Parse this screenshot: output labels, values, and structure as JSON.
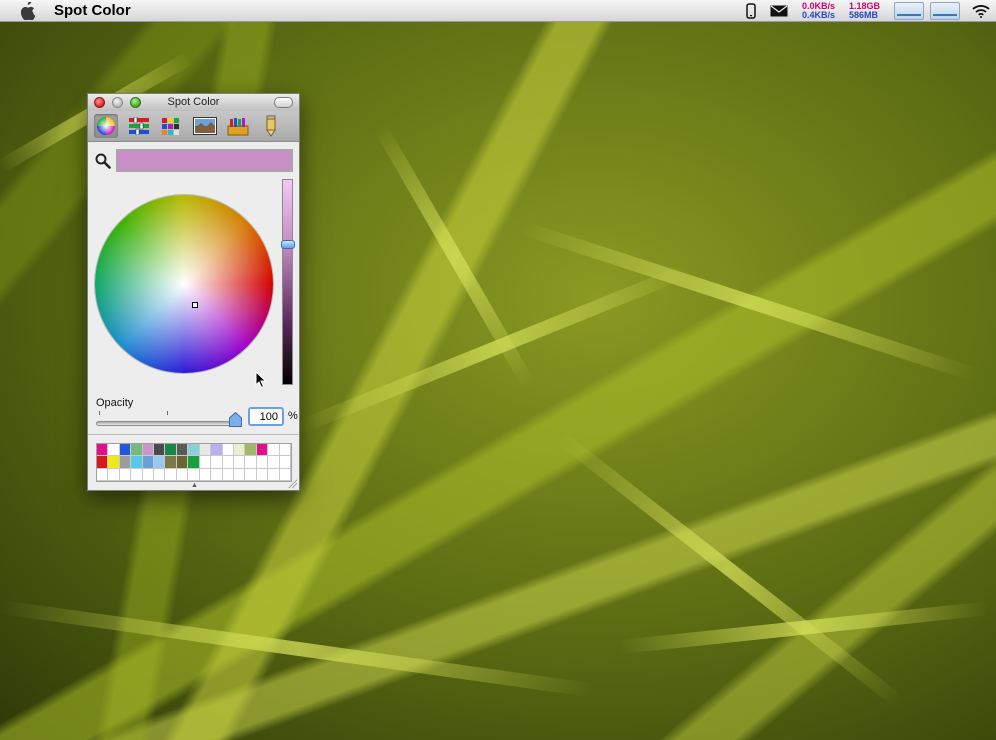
{
  "menubar": {
    "app_name": "Spot Color",
    "icons": [
      "apple-icon",
      "phone-icon",
      "mail-icon",
      "wifi-icon"
    ],
    "network": {
      "up": "0.0KB/s",
      "down": "0.4KB/s"
    },
    "memory": {
      "used": "1.18GB",
      "free": "586MB"
    }
  },
  "panel": {
    "title": "Spot Color",
    "modes": [
      "color-wheel-icon",
      "sliders-icon",
      "palettes-icon",
      "image-palette-icon",
      "crayons-icon",
      "pencil-icon"
    ],
    "active_mode": "color-wheel-icon",
    "selected_color": "#c88ec7",
    "opacity_label": "Opacity",
    "opacity_value": "100",
    "opacity_unit": "%",
    "opacity_fraction": 1.0,
    "brightness_fraction": 0.7,
    "swatches": [
      "#e0108a",
      "#ffffff",
      "#2458d8",
      "#74b882",
      "#c896c8",
      "#4a4a4a",
      "#188848",
      "#5a5a5a",
      "#8ad0d8",
      "#e8e8e8",
      "#b8b0f0",
      "#ffffff",
      "#e8f0d0",
      "#a0b868",
      "#e0108a",
      "#ffffff",
      "#ffffff",
      "#d81818",
      "#f0e818",
      "#9c9c9c",
      "#58c8e8",
      "#6aa0d8",
      "#98c8f0",
      "#7a7a48",
      "#686830",
      "#18a040",
      "#ffffff",
      "#ffffff",
      "#ffffff",
      "#ffffff",
      "#ffffff",
      "#ffffff",
      "#ffffff",
      "#ffffff",
      "#ffffff",
      "#ffffff",
      "#ffffff",
      "#ffffff",
      "#ffffff",
      "#ffffff",
      "#ffffff",
      "#ffffff",
      "#ffffff",
      "#ffffff",
      "#ffffff",
      "#ffffff",
      "#ffffff",
      "#ffffff",
      "#ffffff",
      "#ffffff",
      "#ffffff"
    ]
  }
}
